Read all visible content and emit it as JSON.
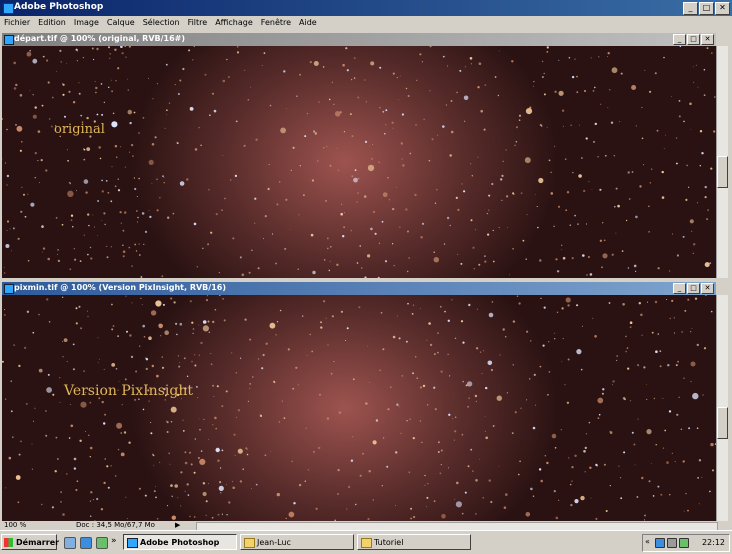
{
  "app": {
    "title": "Adobe Photoshop"
  },
  "window_controls": {
    "minimize": "_",
    "maximize": "□",
    "close": "✕"
  },
  "menu": [
    "Fichier",
    "Edition",
    "Image",
    "Calque",
    "Sélection",
    "Filtre",
    "Affichage",
    "Fenêtre",
    "Aide"
  ],
  "documents": [
    {
      "title": "départ.tif @ 100% (original, RVB/16#)",
      "caption": "original"
    },
    {
      "title": "pixmin.tif @ 100% (Version PixInsight, RVB/16)",
      "caption": "Version PixInsight"
    }
  ],
  "status": {
    "zoom": "100 %",
    "doc_info": "Doc : 34,5 Mo/67,7 Mo"
  },
  "taskbar": {
    "start_label": "Démarrer",
    "tasks": [
      {
        "label": "Adobe Photoshop",
        "active": true,
        "icon": "photoshop-icon"
      },
      {
        "label": "Jean-Luc",
        "active": false,
        "icon": "folder-icon"
      },
      {
        "label": "Tutoriel",
        "active": false,
        "icon": "folder-icon"
      }
    ],
    "clock": "22:12"
  },
  "colors": {
    "title_active": "#0a246a",
    "caption_gold": "#e0b75a",
    "nebula": "#b25f5a"
  }
}
